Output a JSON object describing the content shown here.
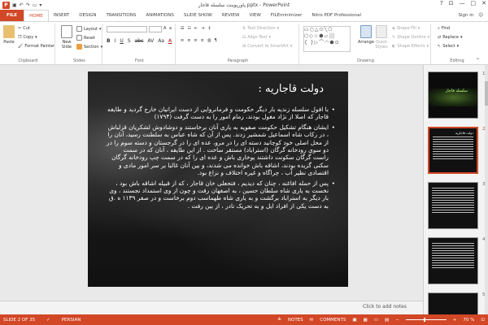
{
  "window": {
    "title": "پاورپوینت سلسله قاجار.pptx - PowerPoint",
    "help": "?",
    "controls": [
      "—",
      "□",
      "✕"
    ]
  },
  "tabs": [
    "FILE",
    "HOME",
    "INSERT",
    "DESIGN",
    "TRANSITIONS",
    "ANIMATIONS",
    "SLIDE SHOW",
    "REVIEW",
    "VIEW",
    "FILEminimizer",
    "Nitro PDF Professional"
  ],
  "account": {
    "sign_in": "Sign in"
  },
  "ribbon": {
    "clipboard": {
      "paste": "Paste",
      "cut": "Cut",
      "copy": "Copy",
      "format_painter": "Format Painter",
      "label": "Clipboard"
    },
    "slides": {
      "new_slide": "New Slide",
      "layout": "Layout",
      "reset": "Reset",
      "section": "Section",
      "label": "Slides"
    },
    "font": {
      "label": "Font",
      "bold": "B",
      "italic": "I",
      "underline": "U",
      "shadow": "S",
      "strike": "abc",
      "spacing": "AV",
      "case": "Aa",
      "color": "A"
    },
    "paragraph": {
      "text_direction": "Text Direction",
      "align_text": "Align Text",
      "smartart": "Convert to SmartArt",
      "label": "Paragraph"
    },
    "drawing": {
      "arrange": "Arrange",
      "quick_styles": "Quick Styles",
      "shape_fill": "Shape Fill",
      "shape_outline": "Shape Outline",
      "shape_effects": "Shape Effects",
      "label": "Drawing"
    },
    "editing": {
      "find": "Find",
      "replace": "Replace",
      "select": "Select",
      "label": "Editing"
    }
  },
  "slide": {
    "heading": "دولت قاجاریه :",
    "bullets": [
      "با افول سلسله زندیه بار دیگر حکومت و فرمانروایی از دست ایرانیان خارج گردید و طایفه قاجار که اصلا از نژاد مغول بودند، زمام امور را به دست گرفت (۱۷۹۴)",
      "ایشان هنگام تشکیل حکومت صفویه به یاری آنان برخاستند و دوشادوش لشکریان قزلباش ، در رکاب شاه اسماعیل شمشیر زدند. پس از آن که شاه عباس به سلطنت رسید، آنان را از محل اصلی خود کوچانید دسته ای را در مرو، عده ای را در گرجستان و دسته سوم را در دو سوی رودخانه گرگان (استراباد) مستقر ساخت . از این طایفه ، آنان که در سمت راست گرگان سکونت داشتند یوخاری باش و عده ای را که در سمت چپ رودخانه گرگان سکنی گزیده بودند، اشاقه باش خوانده می شدند، و بین آنان غالبا بر سر امور مادی و اقتصادی نظیر آب ، چراگاه و غیره اختلاف و نزاع بود.",
      "پس از حمله افاغنه ، چنان که دیدیم ، فتحعلی خان قاجار ، که از قبیله اشاقه باش بود ، نخست به یاری شاه سلطان حسین ، به اصفهان رفت و چون از وی استمداد نجستند ، وی بار دیگر به استراباد برگشت و به یاری شاه طهماسب دوم برخاست و در صفر ۱۱۳۹ ه .ق به دست یکی از افراد ایل و به تحریک نادر ، از بین رفت ."
    ]
  },
  "thumbnails": [
    {
      "num": "1",
      "title": "سلسله قاجار"
    },
    {
      "num": "2",
      "title": "دولت قاجاریه"
    },
    {
      "num": "3",
      "title": ""
    },
    {
      "num": "4",
      "title": ""
    },
    {
      "num": "5",
      "title": ""
    }
  ],
  "notes_placeholder": "Click to add notes",
  "status": {
    "slide_of": "SLIDE 2 OF 35",
    "language": "PERSIAN",
    "notes": "NOTES",
    "comments": "COMMENTS",
    "zoom": "70 %"
  },
  "colors": {
    "accent": "#d24726",
    "slide_bg": "#1a1a1a"
  }
}
